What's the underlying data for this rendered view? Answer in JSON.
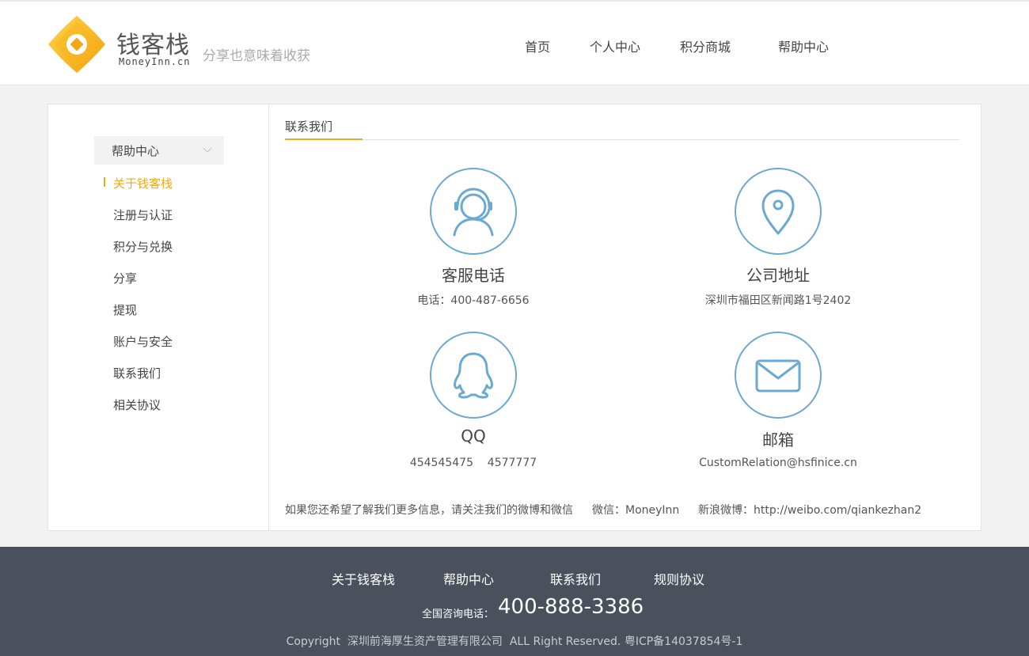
{
  "header": {
    "logo_name": "钱客栈",
    "logo_domain": "MoneyInn.cn",
    "slogan": "分享也意味着收获",
    "nav": [
      "首页",
      "个人中心",
      "积分商城",
      "帮助中心"
    ]
  },
  "sidebar": {
    "heading": "帮助中心",
    "items": [
      "关于钱客栈",
      "注册与认证",
      "积分与兑换",
      "分享",
      "提现",
      "账户与安全",
      "联系我们",
      "相关协议"
    ],
    "active_index": 0
  },
  "content": {
    "title": "联系我们",
    "cards": [
      {
        "icon": "customer-service-headset-icon",
        "title": "客服电话",
        "value": "电话：400-487-6656"
      },
      {
        "icon": "location-pin-icon",
        "title": "公司地址",
        "value": "深圳市福田区新闻路1号2402"
      },
      {
        "icon": "qq-penguin-icon",
        "title": "QQ",
        "value": "454545475    4577777"
      },
      {
        "icon": "mail-envelope-icon",
        "title": "邮箱",
        "value": "CustomRelation@hsfinice.cn"
      }
    ],
    "follow_note": "如果您还希望了解我们更多信息，请关注我们的微博和微信",
    "wechat": "微信：MoneyInn",
    "weibo": "新浪微博：http://weibo.com/qiankezhan2"
  },
  "footer": {
    "links": [
      "关于钱客栈",
      "帮助中心",
      "联系我们",
      "规则协议"
    ],
    "hotline_label": "全国咨询电话：",
    "hotline_number": "400-888-3386",
    "copyright": "Copyright  深圳前海厚生资产管理有限公司  ALL Right Reserved. 粤ICP备14037854号-1"
  },
  "colors": {
    "accent": "#f2a81f",
    "icon_blue": "#6aa9d0",
    "footer_bg": "#4a515c"
  }
}
